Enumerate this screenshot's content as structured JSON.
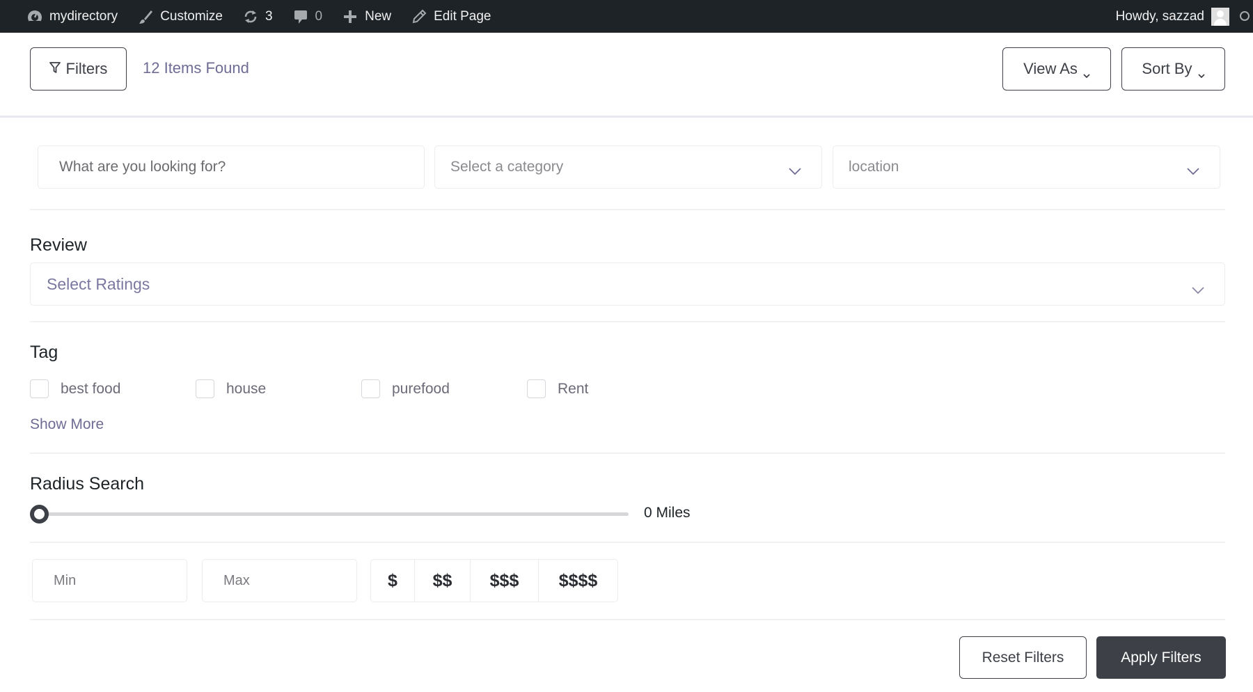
{
  "adminbar": {
    "site_name": "mydirectory",
    "customize": "Customize",
    "updates_count": "3",
    "comments_count": "0",
    "new_label": "New",
    "edit_page": "Edit Page",
    "greeting": "Howdy, sazzad",
    "icons": [
      "dashboard-icon",
      "brush-icon",
      "updates-icon",
      "comment-icon",
      "plus-icon",
      "pencil-icon",
      "avatar",
      "search-icon"
    ]
  },
  "header": {
    "filters_label": "Filters",
    "items_found": "12 Items Found",
    "view_as_label": "View As",
    "sort_by_label": "Sort By"
  },
  "search": {
    "placeholder": "What are you looking for?",
    "category_placeholder": "Select a category",
    "location_placeholder": "location"
  },
  "review": {
    "title": "Review",
    "placeholder": "Select Ratings"
  },
  "tags": {
    "title": "Tag",
    "items": [
      {
        "label": "best food",
        "checked": false
      },
      {
        "label": "house",
        "checked": false
      },
      {
        "label": "purefood",
        "checked": false
      },
      {
        "label": "Rent",
        "checked": false
      }
    ],
    "show_more": "Show More"
  },
  "radius": {
    "title": "Radius Search",
    "value": 0,
    "value_label": "0 Miles",
    "fraction": 0
  },
  "price": {
    "min_placeholder": "Min",
    "max_placeholder": "Max",
    "options": [
      "$",
      "$$",
      "$$$",
      "$$$$"
    ]
  },
  "actions": {
    "reset_label": "Reset Filters",
    "apply_label": "Apply Filters"
  },
  "colors": {
    "adminbar_bg": "#1d2327",
    "accent_text": "#6e6c94",
    "primary_button": "#3e4048"
  }
}
